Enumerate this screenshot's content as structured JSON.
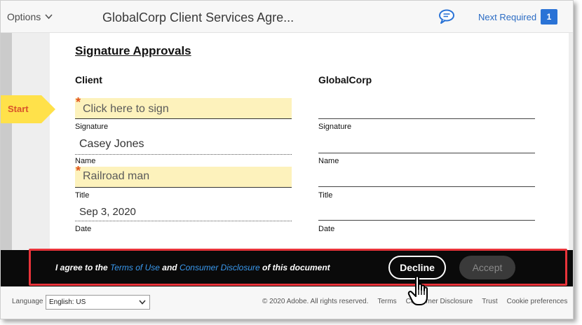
{
  "header": {
    "options_label": "Options",
    "doc_title": "GlobalCorp Client Services Agre...",
    "next_required_label": "Next Required",
    "next_required_count": "1"
  },
  "start_tab": {
    "label": "Start"
  },
  "document": {
    "section_title": "Signature Approvals",
    "client_heading": "Client",
    "globalcorp_heading": "GlobalCorp",
    "client_fields": {
      "signature_placeholder": "Click here to sign",
      "signature_label": "Signature",
      "name_value": "Casey Jones",
      "name_label": "Name",
      "title_value": "Railroad man",
      "title_label": "Title",
      "date_value": "Sep 3, 2020",
      "date_label": "Date",
      "required_mark": "*"
    },
    "globalcorp_fields": {
      "signature_label": "Signature",
      "name_label": "Name",
      "title_label": "Title",
      "date_label": "Date"
    }
  },
  "agreement": {
    "text_prefix": "I agree to the ",
    "terms_link": "Terms of Use",
    "text_and": " and ",
    "disclosure_link": "Consumer Disclosure",
    "text_suffix": " of this document",
    "decline_label": "Decline",
    "accept_label": "Accept"
  },
  "footer": {
    "language_label": "Language",
    "language_value": "English: US",
    "copyright": "© 2020 Adobe. All rights reserved.",
    "links": [
      "Terms",
      "Consumer Disclosure",
      "Trust",
      "Cookie preferences"
    ]
  },
  "colors": {
    "accent_blue": "#2a73d6",
    "start_orange": "#d9532b",
    "field_yellow": "#fdf2bc",
    "highlight_red": "#e8333a"
  }
}
